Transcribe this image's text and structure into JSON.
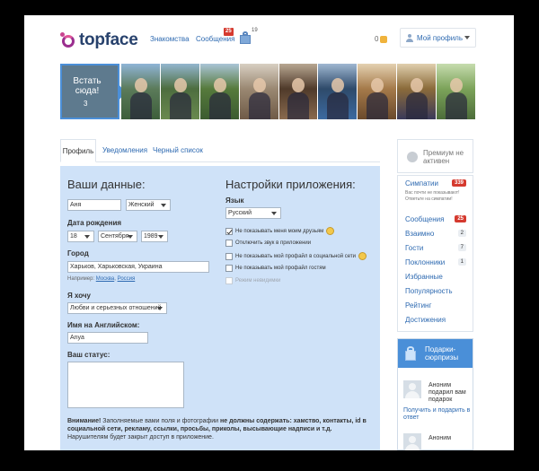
{
  "header": {
    "logo_text": "topface",
    "nav": {
      "events": "Знакомства",
      "messages": "Сообщения",
      "messages_badge": "25",
      "gifts_count": "19"
    },
    "balance": "0",
    "profile_button": "Мой профиль"
  },
  "photos": {
    "entry_text": "Встать сюда!",
    "entry_count": "3",
    "items": [
      {
        "colors": [
          "#5b7b5a",
          "#8fb4d6",
          "#3d5e3a"
        ]
      },
      {
        "colors": [
          "#4d6d3f",
          "#93b6cf",
          "#6a8a4f"
        ]
      },
      {
        "colors": [
          "#567a3c",
          "#a9c4d6",
          "#3b5b30"
        ]
      },
      {
        "colors": [
          "#9a8872",
          "#d8cfc2",
          "#6f5a47"
        ]
      },
      {
        "colors": [
          "#4f3a2a",
          "#b8a792",
          "#8a6a4e"
        ]
      },
      {
        "colors": [
          "#2e4a6a",
          "#9fb7d1",
          "#3c6aa0"
        ]
      },
      {
        "colors": [
          "#a57a4a",
          "#e4d1b1",
          "#6b4a2c"
        ]
      },
      {
        "colors": [
          "#8b6b3a",
          "#e0cfae",
          "#3a3a5a"
        ]
      },
      {
        "colors": [
          "#7ca35a",
          "#c6dcae",
          "#4d6d3a"
        ]
      }
    ]
  },
  "tabs": [
    "Профиль",
    "Уведомления",
    "Черный список"
  ],
  "form": {
    "your_data_title": "Ваши данные:",
    "name_value": "Аня",
    "gender_value": "Женский",
    "birthday_label": "Дата рождения",
    "day_value": "18",
    "month_value": "Сентября",
    "year_value": "1989",
    "city_label": "Город",
    "city_value": "Харьков, Харьковская, Украина",
    "city_example_prefix": "Например:",
    "city_example_1": "Москва",
    "city_example_sep": ", ",
    "city_example_2": "Россия",
    "want_label": "Я хочу",
    "want_value": "Любви и серьезных отношений",
    "english_name_label": "Имя на Английском:",
    "english_name_value": "Anya",
    "status_label": "Ваш статус:",
    "app_settings_title": "Настройки приложения:",
    "language_label": "Язык",
    "language_value": "Русский",
    "checkboxes": [
      {
        "label": "Не показывать меня моим друзьям",
        "checked": true,
        "emoji": true
      },
      {
        "label": "Отключить звук в приложении",
        "checked": false,
        "emoji": false
      },
      {
        "label": "Не показывать мой профайл в социальной сети",
        "checked": false,
        "emoji": true
      },
      {
        "label": "Не показывать мой профайл гостям",
        "checked": false,
        "emoji": false
      },
      {
        "label": "Режим невидимки",
        "checked": false,
        "emoji": false,
        "disabled": true
      }
    ],
    "warning_bold_1": "Внимание!",
    "warning_text_1": " Заполняемые вами поля и фотографии ",
    "warning_bold_2": "не должны содержать: хамство, контакты, id в социальной сети, рекламу, ссылки, просьбы, приколы, высывающие надписи и т.д.",
    "warning_text_2": " Нарушителям будет закрыт доступ в приложение."
  },
  "sidebar": {
    "premium": "Премиум не активен",
    "menu": [
      {
        "label": "Симпатии",
        "badge": "339",
        "badge_red": true
      },
      {
        "label": "Сообщения",
        "badge": "25",
        "badge_red": true
      },
      {
        "label": "Взаимно",
        "badge": "2",
        "badge_red": false
      },
      {
        "label": "Гости",
        "badge": "7",
        "badge_red": false
      },
      {
        "label": "Поклонники",
        "badge": "1",
        "badge_red": false
      },
      {
        "label": "Избранные",
        "badge": "",
        "badge_red": false
      },
      {
        "label": "Популярность",
        "badge": "",
        "badge_red": false
      },
      {
        "label": "Рейтинг",
        "badge": "",
        "badge_red": false
      },
      {
        "label": "Достижения",
        "badge": "",
        "badge_red": false
      }
    ],
    "sympathy_note": "Вас почти не показывают! Ответьте на симпатии!",
    "gifts_title": "Подарки-сюрпризы",
    "gift_1_name": "Аноним подарил вам подарок",
    "gift_1_link": "Получить и подарить в ответ",
    "gift_2_name": "Аноним"
  }
}
